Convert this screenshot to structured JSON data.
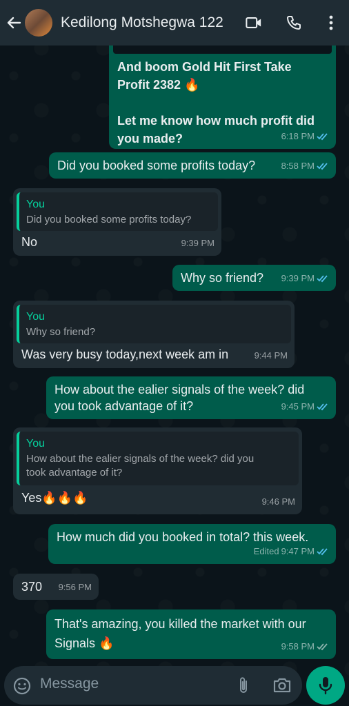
{
  "header": {
    "title": "Kedilong Motshegwa 122"
  },
  "messages": [
    {
      "lines": [
        "And boom Gold Hit First Take",
        "Profit 2382 🔥",
        "",
        "Let me know how much profit did",
        "you made?"
      ],
      "time": "6:18 PM"
    },
    {
      "text": "Did you booked some profits today?",
      "time": "8:58 PM"
    },
    {
      "quote_author": "You",
      "quote_text": "Did you booked some profits today?",
      "text": "No",
      "time": "9:39 PM"
    },
    {
      "text": "Why so friend?",
      "time": "9:39 PM"
    },
    {
      "quote_author": "You",
      "quote_text": "Why so friend?",
      "text": "Was very busy today,next week am in",
      "time": "9:44 PM"
    },
    {
      "lines": [
        "How about the ealier signals of the week? did",
        "you took advantage of it?"
      ],
      "time": "9:45 PM"
    },
    {
      "quote_author": "You",
      "quote_lines": [
        "How about the ealier signals of the week? did you",
        "took advantage of it?"
      ],
      "text": "Yes🔥🔥🔥",
      "time": "9:46 PM"
    },
    {
      "text": "How much did you booked in total? this week.",
      "edited": "Edited",
      "time": "9:47 PM"
    },
    {
      "text": "370",
      "time": "9:56 PM"
    },
    {
      "lines": [
        "That's amazing, you killed the market with our",
        "Signals 🔥"
      ],
      "time": "9:58 PM"
    }
  ],
  "composer": {
    "placeholder": "Message"
  },
  "colors": {
    "outgoing": "#005c4b",
    "incoming": "#202c33",
    "accent": "#00a884",
    "quote_author": "#06cf9c",
    "read_tick": "#53bdeb"
  },
  "icons": [
    "back-arrow-icon",
    "video-call-icon",
    "phone-call-icon",
    "more-options-icon",
    "emoji-icon",
    "attach-icon",
    "camera-icon",
    "mic-icon",
    "read-receipt-icon"
  ]
}
